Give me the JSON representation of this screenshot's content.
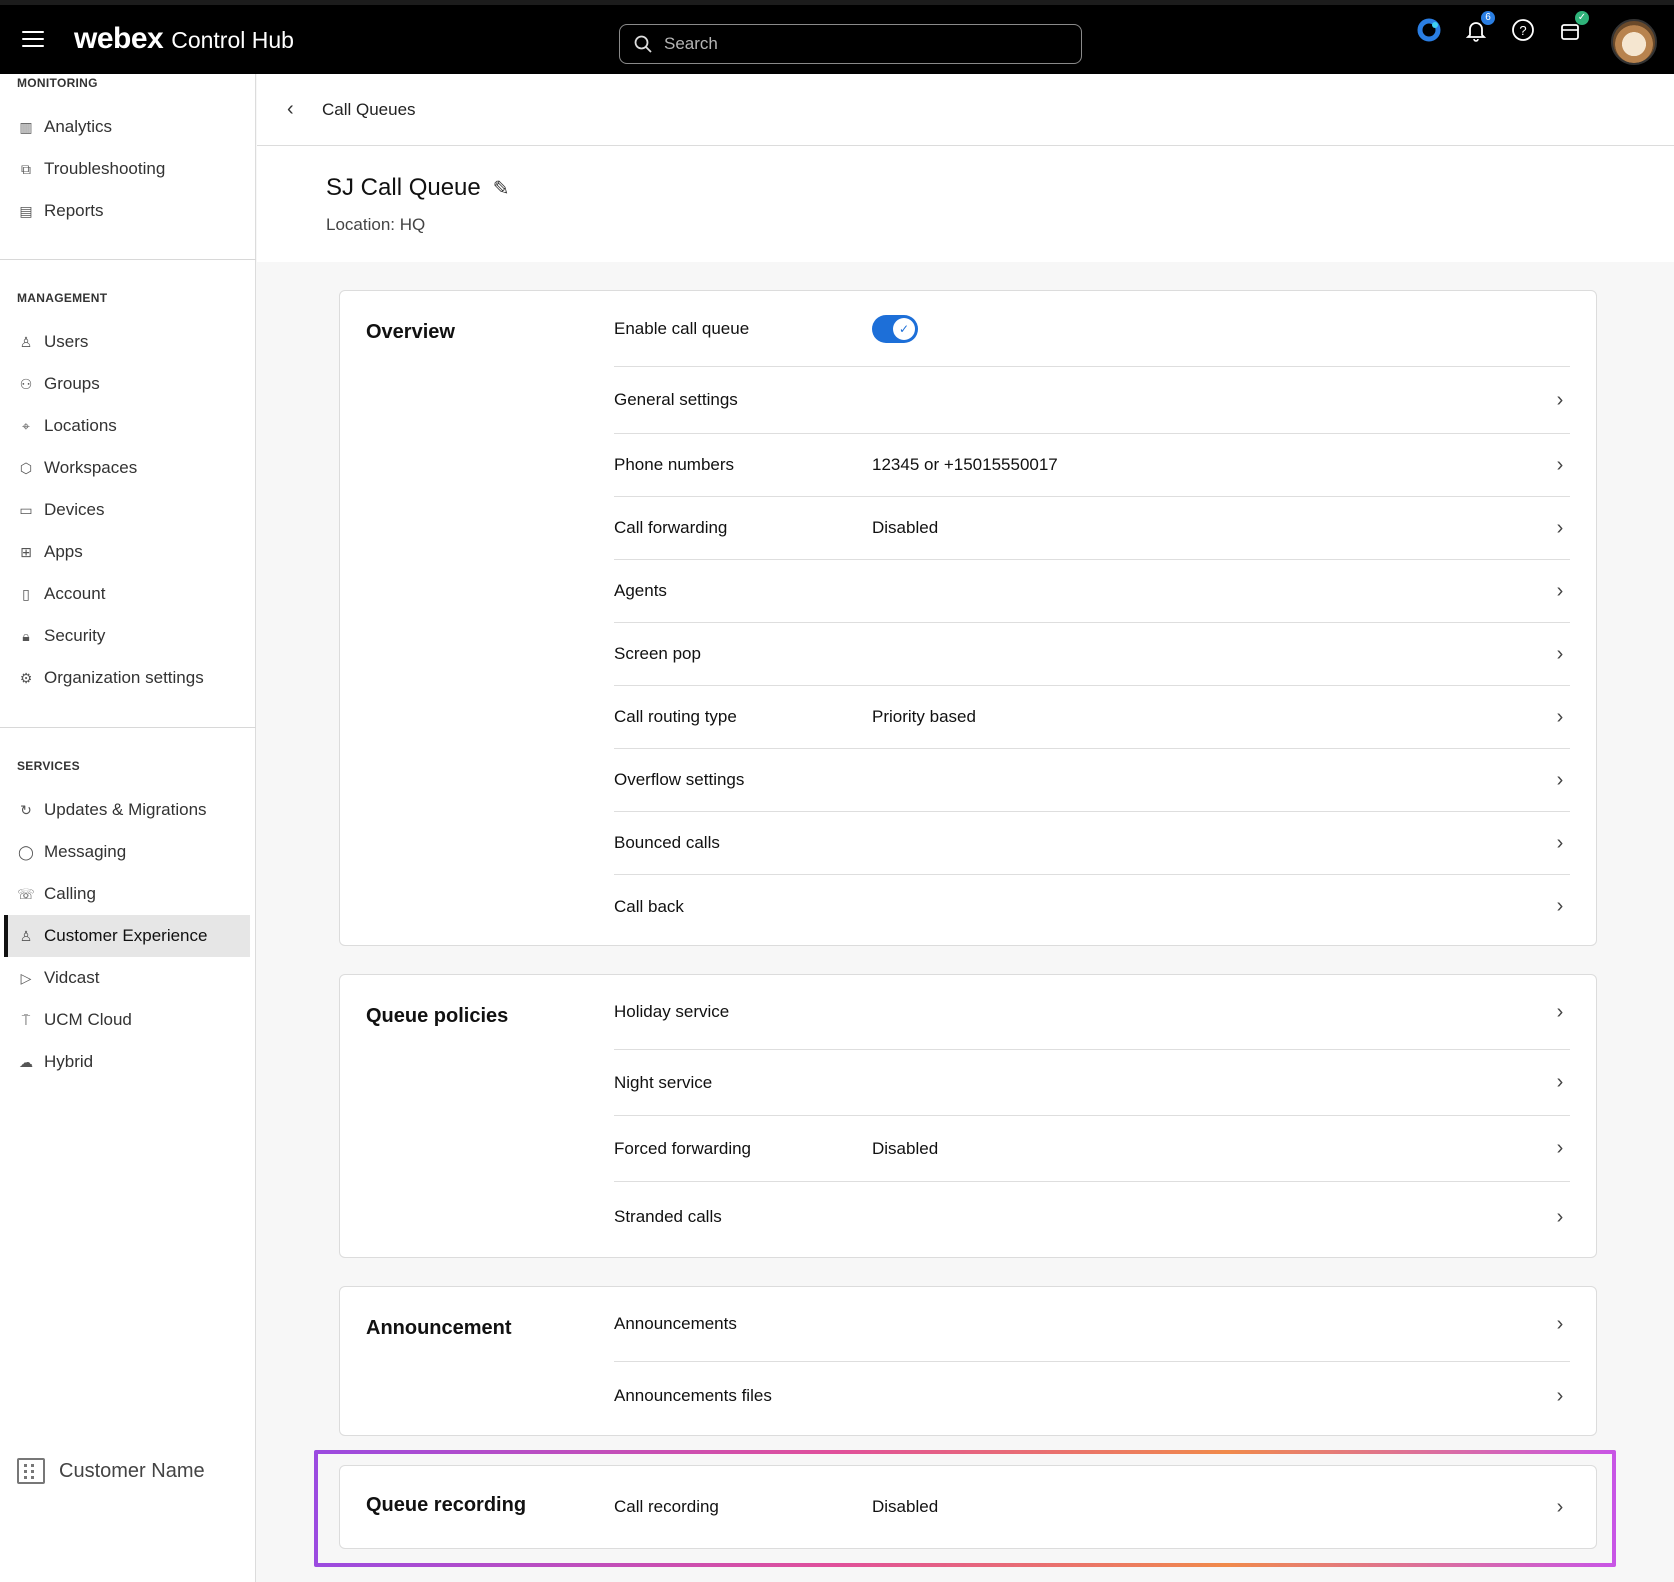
{
  "topbar": {
    "brand_logo": "webex",
    "brand_product": "Control Hub",
    "search_placeholder": "Search",
    "notification_count": "6",
    "icons": [
      "menu-icon",
      "webex-status-icon",
      "bell-icon",
      "help-icon",
      "cart-icon"
    ]
  },
  "sidebar": {
    "monitoring": {
      "title": "MONITORING",
      "items": [
        {
          "label": "Analytics",
          "icon": "analytics-icon"
        },
        {
          "label": "Troubleshooting",
          "icon": "troubleshooting-icon"
        },
        {
          "label": "Reports",
          "icon": "reports-icon"
        }
      ]
    },
    "management": {
      "title": "MANAGEMENT",
      "items": [
        {
          "label": "Users",
          "icon": "user-icon"
        },
        {
          "label": "Groups",
          "icon": "groups-icon"
        },
        {
          "label": "Locations",
          "icon": "location-pin-icon"
        },
        {
          "label": "Workspaces",
          "icon": "workspaces-icon"
        },
        {
          "label": "Devices",
          "icon": "devices-icon"
        },
        {
          "label": "Apps",
          "icon": "apps-icon"
        },
        {
          "label": "Account",
          "icon": "account-icon"
        },
        {
          "label": "Security",
          "icon": "lock-icon"
        },
        {
          "label": "Organization settings",
          "icon": "gear-icon"
        }
      ]
    },
    "services": {
      "title": "SERVICES",
      "items": [
        {
          "label": "Updates & Migrations",
          "icon": "refresh-icon"
        },
        {
          "label": "Messaging",
          "icon": "message-icon"
        },
        {
          "label": "Calling",
          "icon": "phone-icon"
        },
        {
          "label": "Customer Experience",
          "icon": "headset-icon",
          "active": true
        },
        {
          "label": "Vidcast",
          "icon": "play-icon"
        },
        {
          "label": "UCM Cloud",
          "icon": "cloud-tower-icon"
        },
        {
          "label": "Hybrid",
          "icon": "cloud-icon"
        }
      ]
    },
    "customer_name": "Customer Name"
  },
  "header": {
    "breadcrumb": "Call Queues",
    "title": "SJ Call Queue",
    "location": "Location: HQ"
  },
  "overview": {
    "title": "Overview",
    "enable_label": "Enable call queue",
    "enabled": true,
    "rows": [
      {
        "label": "General settings",
        "value": ""
      },
      {
        "label": "Phone numbers",
        "value": "12345 or +15015550017"
      },
      {
        "label": "Call forwarding",
        "value": "Disabled"
      },
      {
        "label": "Agents",
        "value": ""
      },
      {
        "label": "Screen pop",
        "value": ""
      },
      {
        "label": "Call routing type",
        "value": "Priority based"
      },
      {
        "label": "Overflow settings",
        "value": ""
      },
      {
        "label": "Bounced calls",
        "value": ""
      },
      {
        "label": "Call back",
        "value": ""
      }
    ]
  },
  "queue_policies": {
    "title": "Queue policies",
    "rows": [
      {
        "label": "Holiday service",
        "value": ""
      },
      {
        "label": "Night service",
        "value": ""
      },
      {
        "label": "Forced forwarding",
        "value": "Disabled"
      },
      {
        "label": "Stranded calls",
        "value": ""
      }
    ]
  },
  "announcement": {
    "title": "Announcement",
    "rows": [
      {
        "label": "Announcements",
        "value": ""
      },
      {
        "label": "Announcements files",
        "value": ""
      }
    ]
  },
  "queue_recording": {
    "title": "Queue recording",
    "rows": [
      {
        "label": "Call recording",
        "value": "Disabled"
      }
    ]
  }
}
